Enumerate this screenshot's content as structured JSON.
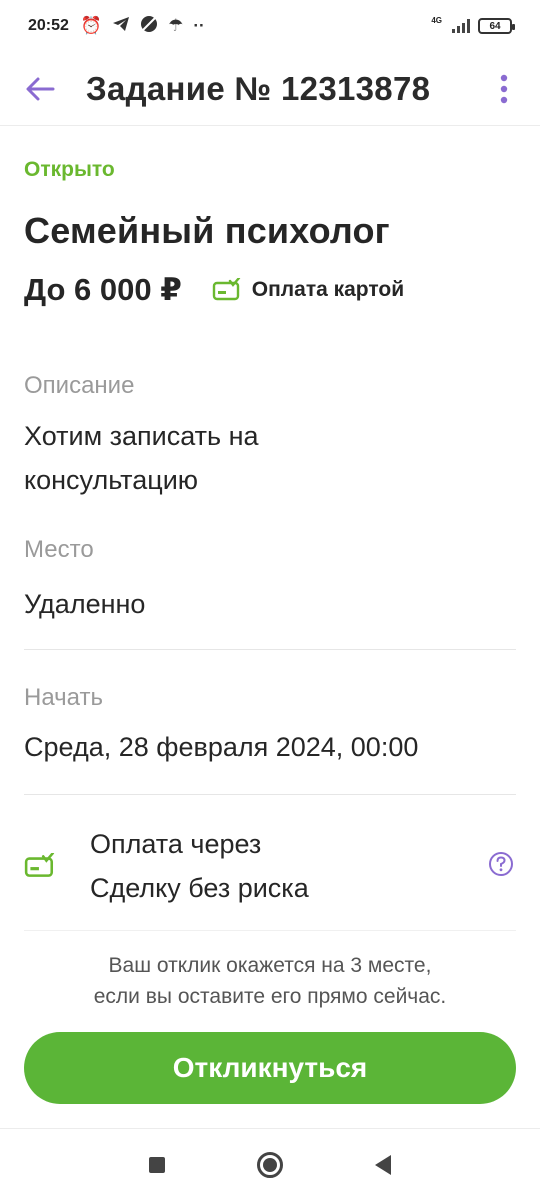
{
  "status_bar": {
    "time": "20:52",
    "network": "4G",
    "battery": "64"
  },
  "header": {
    "title": "Задание № 12313878"
  },
  "task": {
    "status": "Открыто",
    "title": "Семейный психолог",
    "price": "До 6 000 ₽",
    "payment_method": "Оплата картой"
  },
  "description": {
    "label": "Описание",
    "value": "Хотим записать на консультацию"
  },
  "place": {
    "label": "Место",
    "value": "Удаленно"
  },
  "start": {
    "label": "Начать",
    "value": "Среда, 28 февраля 2024, 00:00"
  },
  "deal": {
    "line1": "Оплата через",
    "line2": "Сделку без риска"
  },
  "notice": {
    "line1": "Ваш отклик окажется на 3 месте,",
    "line2": "если вы оставите его прямо сейчас."
  },
  "actions": {
    "respond_label": "Откликнуться"
  },
  "colors": {
    "accent_green": "#5bb537",
    "status_green": "#6ab82f",
    "icon_purple": "#8a6bd1"
  }
}
